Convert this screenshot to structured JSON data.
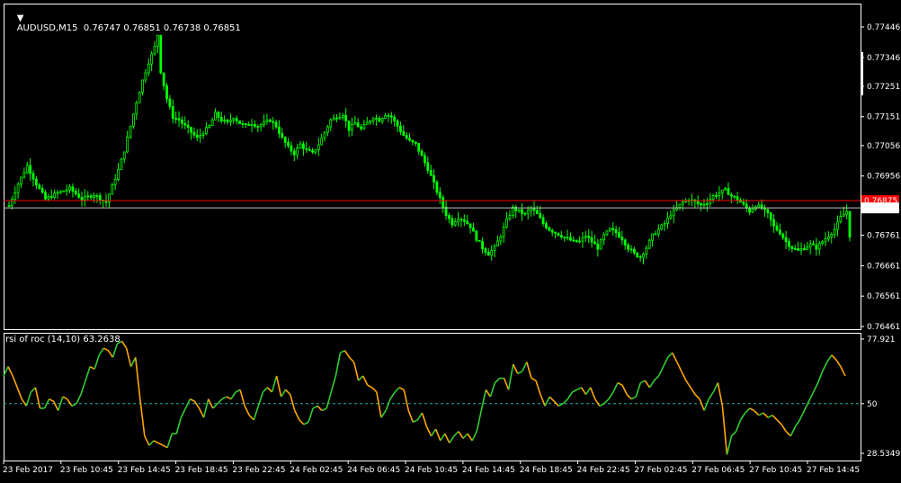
{
  "window": {
    "symbol_line": "AUDUSD,M15  0.76747 0.76851 0.76738 0.76851"
  },
  "price_panel": {
    "current_price_label": "0.76851",
    "red_line_label": "0.76875"
  },
  "indicator_panel": {
    "label": "rsi of roc (14,10) 63.2638"
  },
  "colors": {
    "background": "#000000",
    "candle": "#00ff00",
    "red_level": "#ff0000",
    "bid_line": "#c0c0c0",
    "indicator_up": "#32cd32",
    "indicator_down": "#ffa500",
    "indicator_level": "#20b2aa"
  },
  "chart_data": [
    {
      "type": "candlestick",
      "title": "AUDUSD,M15",
      "ylim": [
        0.76461,
        0.77446
      ],
      "yticks": [
        "0.77446",
        "0.77346",
        "0.77251",
        "0.77151",
        "0.77056",
        "0.76956",
        "0.76851",
        "0.76761",
        "0.76661",
        "0.76561",
        "0.76461"
      ],
      "levels": [
        0.76875,
        0.76851
      ],
      "x_tick_labels": [
        "23 Feb 2017",
        "23 Feb 10:45",
        "23 Feb 14:45",
        "23 Feb 18:45",
        "23 Feb 22:45",
        "24 Feb 02:45",
        "24 Feb 06:45",
        "24 Feb 10:45",
        "24 Feb 14:45",
        "24 Feb 18:45",
        "24 Feb 22:45",
        "27 Feb 02:45",
        "27 Feb 06:45",
        "27 Feb 10:45",
        "27 Feb 14:45"
      ],
      "close_path": [
        [
          0,
          0.76858
        ],
        [
          3,
          0.7693
        ],
        [
          6,
          0.7699
        ],
        [
          9,
          0.7693
        ],
        [
          12,
          0.7688
        ],
        [
          16,
          0.769
        ],
        [
          20,
          0.76915
        ],
        [
          24,
          0.7688
        ],
        [
          28,
          0.76895
        ],
        [
          32,
          0.7687
        ],
        [
          36,
          0.76975
        ],
        [
          38,
          0.7704
        ],
        [
          40,
          0.7712
        ],
        [
          42,
          0.772
        ],
        [
          44,
          0.7727
        ],
        [
          46,
          0.7733
        ],
        [
          48,
          0.7738
        ],
        [
          49,
          0.7742
        ],
        [
          50,
          0.773
        ],
        [
          52,
          0.7721
        ],
        [
          54,
          0.7715
        ],
        [
          56,
          0.7714
        ],
        [
          58,
          0.7712
        ],
        [
          60,
          0.771
        ],
        [
          62,
          0.7708
        ],
        [
          64,
          0.771
        ],
        [
          66,
          0.7712
        ],
        [
          68,
          0.7716
        ],
        [
          70,
          0.7714
        ],
        [
          72,
          0.7713
        ],
        [
          74,
          0.7715
        ],
        [
          76,
          0.7713
        ],
        [
          78,
          0.7712
        ],
        [
          80,
          0.7713
        ],
        [
          82,
          0.7712
        ],
        [
          84,
          0.7713
        ],
        [
          86,
          0.7714
        ],
        [
          88,
          0.7712
        ],
        [
          90,
          0.7708
        ],
        [
          92,
          0.7705
        ],
        [
          94,
          0.7703
        ],
        [
          96,
          0.7706
        ],
        [
          98,
          0.7704
        ],
        [
          100,
          0.7703
        ],
        [
          102,
          0.7706
        ],
        [
          104,
          0.771
        ],
        [
          106,
          0.7714
        ],
        [
          108,
          0.7715
        ],
        [
          110,
          0.7716
        ],
        [
          112,
          0.7711
        ],
        [
          114,
          0.7713
        ],
        [
          116,
          0.7711
        ],
        [
          118,
          0.7713
        ],
        [
          120,
          0.7715
        ],
        [
          122,
          0.7714
        ],
        [
          124,
          0.7716
        ],
        [
          126,
          0.7715
        ],
        [
          128,
          0.7712
        ],
        [
          130,
          0.7709
        ],
        [
          132,
          0.7707
        ],
        [
          134,
          0.7706
        ],
        [
          136,
          0.7702
        ],
        [
          138,
          0.7698
        ],
        [
          140,
          0.7693
        ],
        [
          142,
          0.7688
        ],
        [
          144,
          0.7683
        ],
        [
          146,
          0.768
        ],
        [
          148,
          0.7682
        ],
        [
          150,
          0.7681
        ],
        [
          152,
          0.7679
        ],
        [
          154,
          0.7675
        ],
        [
          156,
          0.7672
        ],
        [
          158,
          0.767
        ],
        [
          160,
          0.7672
        ],
        [
          162,
          0.7676
        ],
        [
          164,
          0.7681
        ],
        [
          166,
          0.7685
        ],
        [
          168,
          0.7684
        ],
        [
          170,
          0.7683
        ],
        [
          172,
          0.7685
        ],
        [
          174,
          0.7683
        ],
        [
          176,
          0.768
        ],
        [
          178,
          0.7678
        ],
        [
          180,
          0.7677
        ],
        [
          182,
          0.7676
        ],
        [
          184,
          0.7675
        ],
        [
          186,
          0.7674
        ],
        [
          188,
          0.7674
        ],
        [
          190,
          0.7676
        ],
        [
          192,
          0.7674
        ],
        [
          194,
          0.7672
        ],
        [
          196,
          0.7676
        ],
        [
          198,
          0.7678
        ],
        [
          200,
          0.7677
        ],
        [
          202,
          0.7675
        ],
        [
          204,
          0.7672
        ],
        [
          206,
          0.767
        ],
        [
          208,
          0.7669
        ],
        [
          210,
          0.7672
        ],
        [
          212,
          0.7676
        ],
        [
          214,
          0.7678
        ],
        [
          216,
          0.768
        ],
        [
          218,
          0.7683
        ],
        [
          220,
          0.7685
        ],
        [
          222,
          0.7687
        ],
        [
          224,
          0.7688
        ],
        [
          226,
          0.7687
        ],
        [
          228,
          0.7686
        ],
        [
          230,
          0.7687
        ],
        [
          232,
          0.7689
        ],
        [
          234,
          0.769
        ],
        [
          236,
          0.7691
        ],
        [
          238,
          0.7689
        ],
        [
          240,
          0.7688
        ],
        [
          242,
          0.7686
        ],
        [
          244,
          0.7684
        ],
        [
          246,
          0.7686
        ],
        [
          248,
          0.7685
        ],
        [
          250,
          0.7683
        ],
        [
          252,
          0.7679
        ],
        [
          254,
          0.7677
        ],
        [
          256,
          0.7674
        ],
        [
          258,
          0.7672
        ],
        [
          260,
          0.7671
        ],
        [
          262,
          0.7672
        ],
        [
          264,
          0.7673
        ],
        [
          266,
          0.7672
        ],
        [
          268,
          0.7674
        ],
        [
          270,
          0.7676
        ],
        [
          272,
          0.7678
        ],
        [
          274,
          0.7682
        ],
        [
          276,
          0.7684
        ],
        [
          277,
          0.7676
        ]
      ]
    },
    {
      "type": "line",
      "title": "rsi of roc (14,10) 63.2638",
      "ylim": [
        28.5349,
        77.921
      ],
      "yticks": [
        "77.921",
        "50",
        "28.5349"
      ],
      "levels": [
        50
      ],
      "series": [
        {
          "values": [
            62,
            66,
            62,
            57,
            52,
            49,
            55,
            57,
            48,
            48,
            52,
            51,
            47,
            53,
            52,
            49,
            50,
            54,
            60,
            66,
            65,
            71,
            74,
            73,
            70,
            76,
            77,
            74,
            66,
            70,
            52,
            36,
            32,
            34,
            33,
            32,
            31,
            37,
            37,
            44,
            48,
            52,
            51,
            48,
            44,
            52,
            48,
            50,
            52,
            53,
            52,
            55,
            56,
            49,
            45,
            43,
            49,
            55,
            57,
            55,
            62,
            53,
            56,
            54,
            47,
            43,
            41,
            42,
            48,
            49,
            47,
            48,
            55,
            62,
            72,
            73,
            70,
            68,
            60,
            62,
            58,
            57,
            55,
            44,
            47,
            52,
            55,
            57,
            56,
            47,
            42,
            43,
            46,
            40,
            36,
            39,
            34,
            37,
            33,
            36,
            38,
            35,
            37,
            34,
            38,
            47,
            56,
            53,
            59,
            61,
            61,
            56,
            67,
            63,
            64,
            68,
            61,
            60,
            54,
            49,
            53,
            51,
            49,
            50,
            52,
            55,
            56,
            57,
            54,
            57,
            52,
            49,
            50,
            52,
            55,
            59,
            58,
            54,
            52,
            53,
            59,
            60,
            57,
            60,
            62,
            66,
            70,
            72,
            68,
            64,
            60,
            57,
            54,
            52,
            47,
            52,
            55,
            59,
            49,
            28,
            36,
            38,
            43,
            46,
            48,
            47,
            45,
            46,
            44,
            45,
            43,
            41,
            38,
            36,
            40,
            43,
            47,
            51,
            55,
            59,
            64,
            68,
            71,
            69,
            66,
            62
          ]
        }
      ]
    }
  ]
}
